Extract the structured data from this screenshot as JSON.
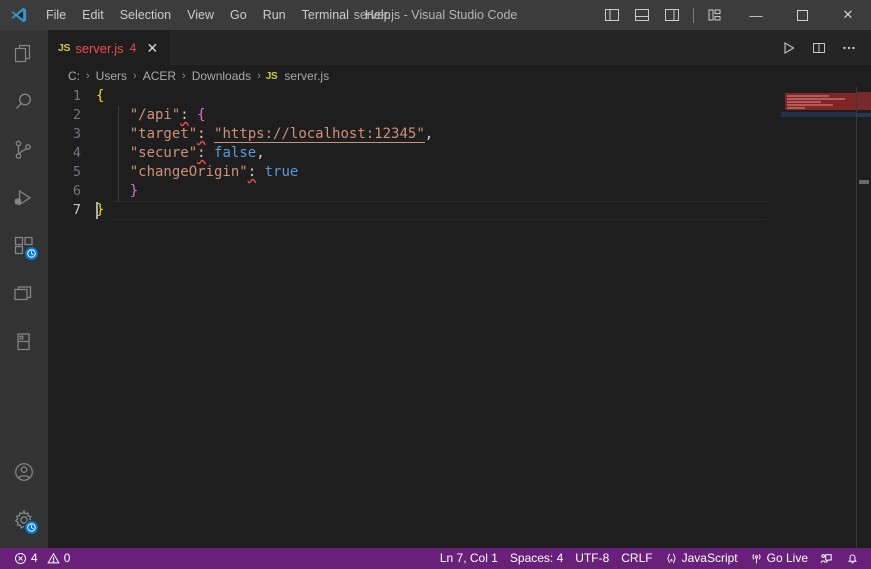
{
  "titlebar": {
    "logo_icon": "vscode-logo-icon",
    "menu": [
      {
        "label": "File"
      },
      {
        "label": "Edit"
      },
      {
        "label": "Selection"
      },
      {
        "label": "View"
      },
      {
        "label": "Go"
      },
      {
        "label": "Run"
      },
      {
        "label": "Terminal"
      },
      {
        "label": "Help"
      }
    ],
    "title": "server.js - Visual Studio Code",
    "layout_icons": [
      {
        "name": "toggle-primary-sidebar-icon"
      },
      {
        "name": "toggle-panel-icon"
      },
      {
        "name": "toggle-secondary-sidebar-icon"
      },
      {
        "name": "customize-layout-icon"
      }
    ],
    "window_controls": {
      "minimize": "—",
      "maximize": "☐",
      "close": "✕"
    }
  },
  "activitybar": {
    "top_items": [
      {
        "name": "explorer",
        "icon": "files-icon",
        "badge": null
      },
      {
        "name": "search",
        "icon": "search-icon",
        "badge": null
      },
      {
        "name": "source-control",
        "icon": "source-control-icon",
        "badge": null
      },
      {
        "name": "run-and-debug",
        "icon": "run-debug-icon",
        "badge": null
      },
      {
        "name": "extensions",
        "icon": "extensions-icon",
        "badge": "clock"
      },
      {
        "name": "remote-explorer",
        "icon": "remote-explorer-icon",
        "badge": null
      },
      {
        "name": "live-server",
        "icon": "book-icon",
        "badge": null
      }
    ],
    "bottom_items": [
      {
        "name": "accounts",
        "icon": "account-icon",
        "badge": null
      },
      {
        "name": "settings",
        "icon": "gear-icon",
        "badge": "clock"
      }
    ]
  },
  "tabs": {
    "active_tab": {
      "file_icon": "JS",
      "label": "server.js",
      "error_badge": "4",
      "close_icon": "✕"
    },
    "actions": [
      {
        "name": "run-code-button",
        "icon": "play-icon"
      },
      {
        "name": "split-editor-button",
        "icon": "split-editor-icon"
      },
      {
        "name": "more-actions-button",
        "icon": "ellipsis-icon"
      }
    ]
  },
  "breadcrumb": {
    "separator": "›",
    "segments": [
      {
        "label": "C:",
        "icon": null
      },
      {
        "label": "Users",
        "icon": null
      },
      {
        "label": "ACER",
        "icon": null
      },
      {
        "label": "Downloads",
        "icon": null
      },
      {
        "label": "server.js",
        "icon": "JS"
      }
    ]
  },
  "editor": {
    "language": "JavaScript",
    "active_line": 7,
    "lines": [
      {
        "number": "1",
        "tokens": [
          {
            "text": "{",
            "type": "bracket1"
          }
        ]
      },
      {
        "number": "2",
        "tokens": [
          {
            "text": "    ",
            "type": "plain"
          },
          {
            "text": "\"/api\"",
            "type": "string"
          },
          {
            "text": ":",
            "type": "error"
          },
          {
            "text": " ",
            "type": "plain"
          },
          {
            "text": "{",
            "type": "bracket2"
          }
        ]
      },
      {
        "number": "3",
        "tokens": [
          {
            "text": "    ",
            "type": "plain"
          },
          {
            "text": "\"target\"",
            "type": "string"
          },
          {
            "text": ":",
            "type": "error"
          },
          {
            "text": " ",
            "type": "plain"
          },
          {
            "text": "\"https://localhost:12345\"",
            "type": "string-link"
          },
          {
            "text": ",",
            "type": "plain"
          }
        ]
      },
      {
        "number": "4",
        "tokens": [
          {
            "text": "    ",
            "type": "plain"
          },
          {
            "text": "\"secure\"",
            "type": "string"
          },
          {
            "text": ":",
            "type": "error"
          },
          {
            "text": " ",
            "type": "plain"
          },
          {
            "text": "false",
            "type": "boolean"
          },
          {
            "text": ",",
            "type": "plain"
          }
        ]
      },
      {
        "number": "5",
        "tokens": [
          {
            "text": "    ",
            "type": "plain"
          },
          {
            "text": "\"changeOrigin\"",
            "type": "string"
          },
          {
            "text": ":",
            "type": "error"
          },
          {
            "text": " ",
            "type": "plain"
          },
          {
            "text": "true",
            "type": "boolean"
          }
        ]
      },
      {
        "number": "6",
        "tokens": [
          {
            "text": "    ",
            "type": "plain"
          },
          {
            "text": "}",
            "type": "bracket2"
          }
        ]
      },
      {
        "number": "7",
        "tokens": [
          {
            "text": "}",
            "type": "bracket1"
          }
        ]
      }
    ]
  },
  "statusbar": {
    "left": [
      {
        "name": "problems",
        "error_icon": "error-circle-icon",
        "error_count": "4",
        "warning_icon": "warning-triangle-icon",
        "warning_count": "0"
      }
    ],
    "right": [
      {
        "name": "cursor-position",
        "label": "Ln 7, Col 1"
      },
      {
        "name": "indentation",
        "label": "Spaces: 4"
      },
      {
        "name": "encoding",
        "label": "UTF-8"
      },
      {
        "name": "line-endings",
        "label": "CRLF"
      },
      {
        "name": "language-mode",
        "label": "JavaScript",
        "icon": "js-braces-icon"
      },
      {
        "name": "go-live",
        "label": "Go Live",
        "icon": "broadcast-icon"
      },
      {
        "name": "feedback",
        "label": "",
        "icon": "feedback-icon"
      },
      {
        "name": "notifications",
        "label": "",
        "icon": "bell-icon"
      }
    ]
  },
  "colors": {
    "titlebar_bg": "#3c3c3c",
    "activitybar_bg": "#333333",
    "editor_bg": "#1e1e1e",
    "tabsbar_bg": "#252526",
    "statusbar_bg": "#68217a",
    "error_red": "#f14c4c",
    "string_orange": "#ce9178",
    "boolean_blue": "#569cd6",
    "bracket1_yellow": "#ffd700",
    "bracket2_pink": "#da70d6",
    "badge_blue": "#0078d4"
  }
}
